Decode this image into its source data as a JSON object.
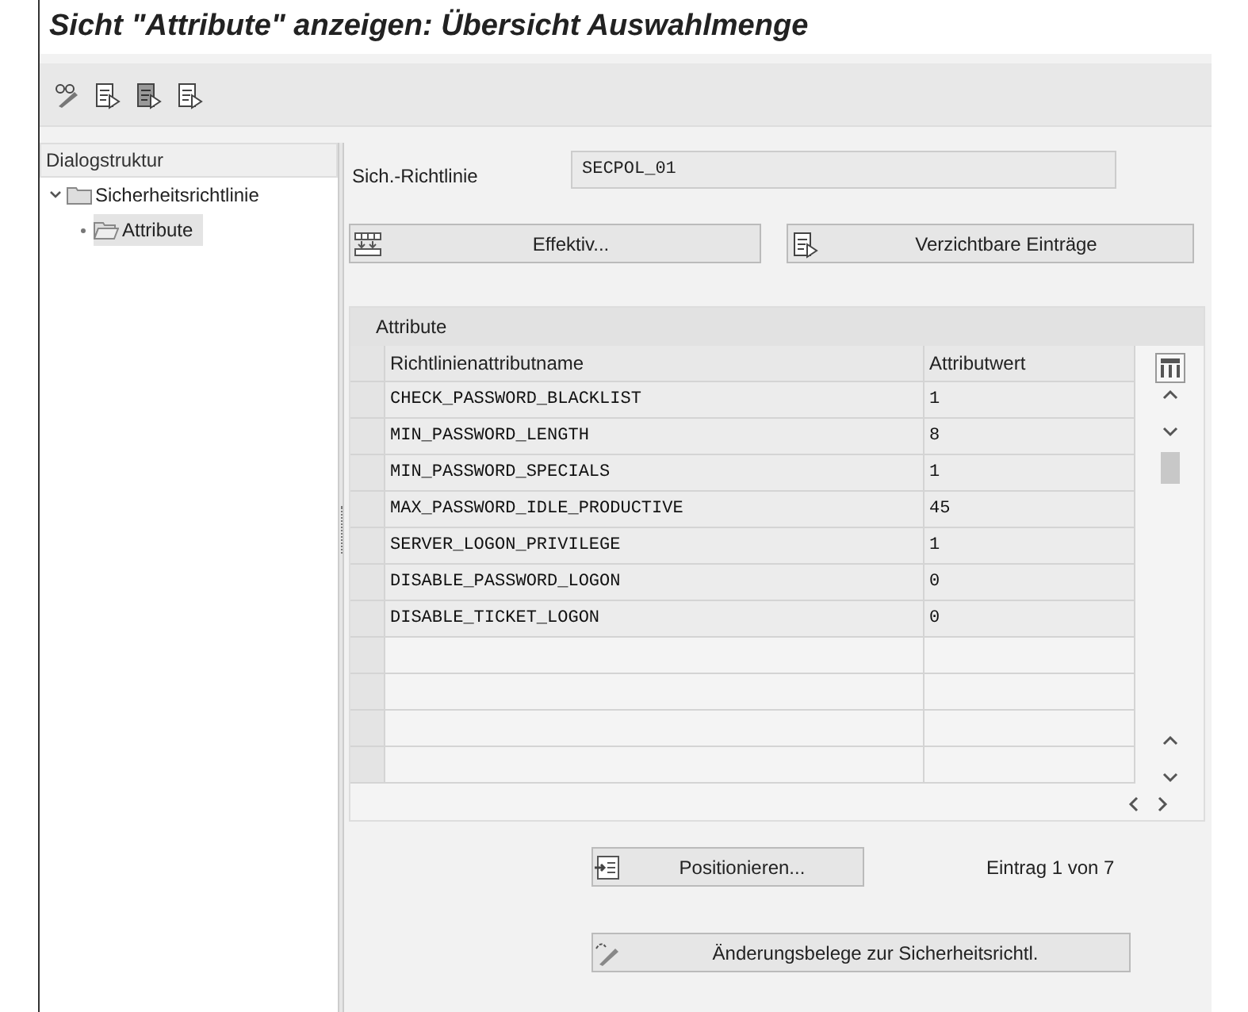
{
  "window": {
    "title": "Sicht \"Attribute\" anzeigen: Übersicht Auswahlmenge"
  },
  "toolbar": {
    "buttons": [
      {
        "kind": "glasses-pencil"
      },
      {
        "kind": "doc-arrow"
      },
      {
        "kind": "doc-arrow-dark"
      },
      {
        "kind": "doc-arrow"
      }
    ]
  },
  "dialog_structure": {
    "title": "Dialogstruktur",
    "items": [
      {
        "label": "Sicherheitsrichtlinie",
        "expanded": true,
        "selected": false,
        "children": [
          {
            "label": "Attribute",
            "selected": true
          }
        ]
      }
    ]
  },
  "policy": {
    "label": "Sich.-Richtlinie",
    "value": "SECPOL_01"
  },
  "buttons": [
    {
      "kind": "grid",
      "label": "Effektiv..."
    },
    {
      "kind": "doc",
      "label": "Verzichtbare Einträge"
    }
  ],
  "table": {
    "title": "Attribute",
    "columns": [
      "Richtlinienattributname",
      "Attributwert"
    ],
    "rows": [
      [
        "CHECK_PASSWORD_BLACKLIST",
        "1"
      ],
      [
        "MIN_PASSWORD_LENGTH",
        "8"
      ],
      [
        "MIN_PASSWORD_SPECIALS",
        "1"
      ],
      [
        "MAX_PASSWORD_IDLE_PRODUCTIVE",
        "45"
      ],
      [
        "SERVER_LOGON_PRIVILEGE",
        "1"
      ],
      [
        "DISABLE_PASSWORD_LOGON",
        "0"
      ],
      [
        "DISABLE_TICKET_LOGON",
        "0"
      ]
    ]
  },
  "position_button": {
    "label": "Positionieren..."
  },
  "entry_info": "Eintrag 1 von 7",
  "change_docs_button": {
    "label": "Änderungsbelege zur Sicherheitsrichtl."
  }
}
